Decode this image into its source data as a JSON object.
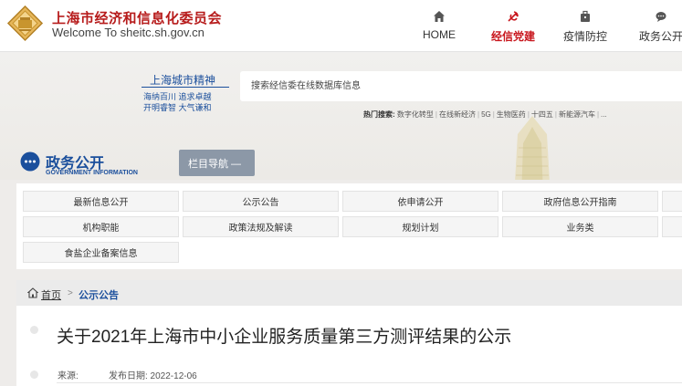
{
  "header": {
    "site_name": "上海市经济和信息化委员会",
    "site_url": "Welcome To sheitc.sh.gov.cn",
    "nav": [
      {
        "label": "HOME",
        "icon": "home-icon"
      },
      {
        "label": "经信党建",
        "icon": "party-emblem-icon",
        "active": true
      },
      {
        "label": "疫情防控",
        "icon": "briefcase-icon"
      },
      {
        "label": "政务公开",
        "icon": "chat-icon"
      }
    ]
  },
  "banner": {
    "slogan_title": "上海城市精神",
    "slogan_line1": "海纳百川 追求卓越",
    "slogan_line2": "开明睿智 大气谦和",
    "search_placeholder": "搜索经信委在线数据库信息",
    "hot_label": "热门搜索:",
    "hot_terms": [
      "数字化转型",
      "在线新经济",
      "5G",
      "生物医药",
      "十四五",
      "新能源汽车",
      "..."
    ]
  },
  "section": {
    "title": "政务公开",
    "subtitle": "GOVERNMENT INFORMATION",
    "column_nav_label": "栏目导航 —"
  },
  "categories": [
    [
      "最新信息公开",
      "公示公告",
      "依申请公开",
      "政府信息公开指南"
    ],
    [
      "机构职能",
      "政策法规及解读",
      "规划计划",
      "业务类"
    ],
    [
      "食盐企业备案信息"
    ]
  ],
  "breadcrumb": {
    "home": "首页",
    "separator": ">",
    "current": "公示公告"
  },
  "article": {
    "title": "关于2021年上海市中小企业服务质量第三方测评结果的公示",
    "source_label": "来源:",
    "date_label": "发布日期: 2022-12-06"
  },
  "colors": {
    "brand_red": "#c8161d",
    "brand_blue": "#1b4f9c",
    "nav_button_gray": "#8c98a7"
  }
}
